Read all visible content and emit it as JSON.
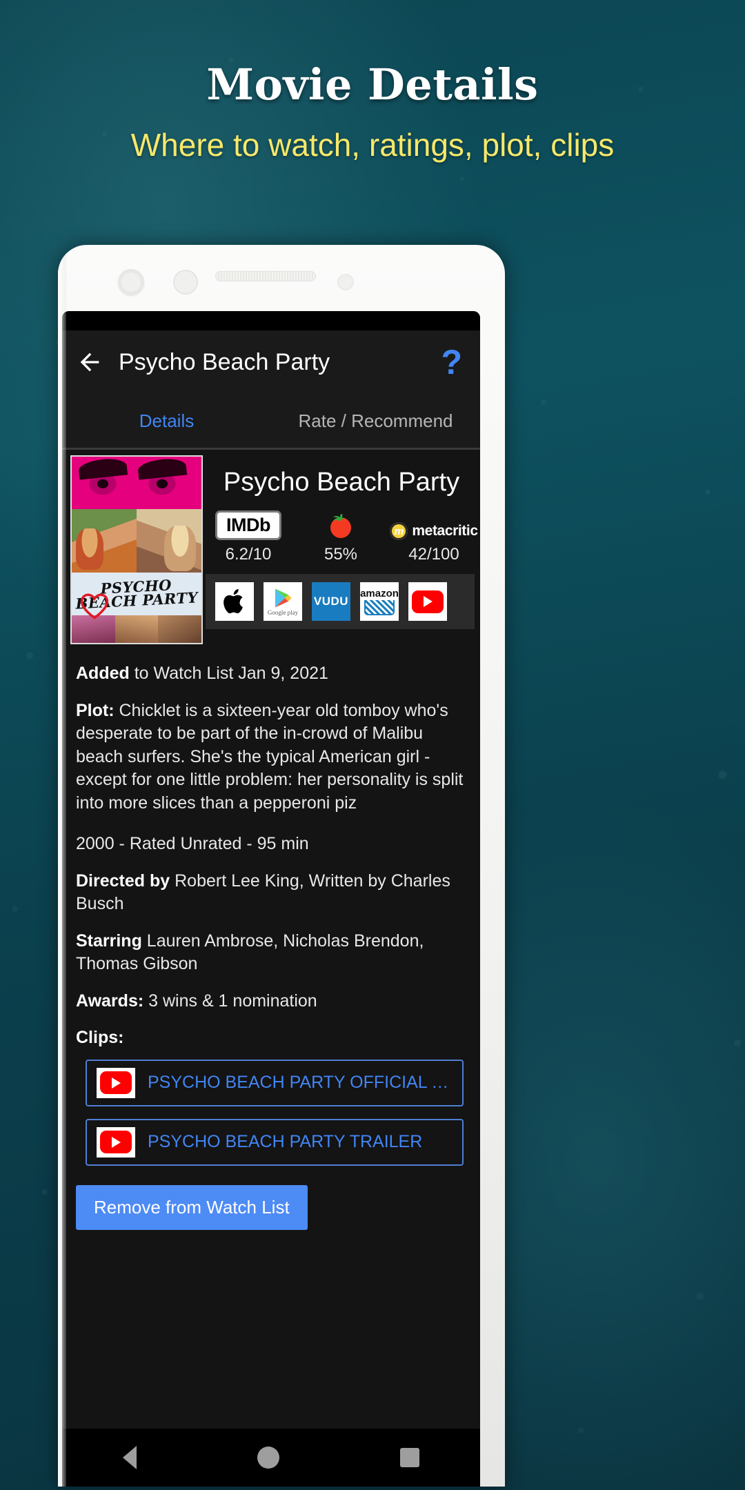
{
  "promo": {
    "title": "Movie Details",
    "subtitle": "Where to watch, ratings,  plot, clips",
    "title_color": "#ffffff",
    "subtitle_color": "#f6e86a",
    "background_color": "#0d4b55"
  },
  "appbar": {
    "back_icon": "arrow-left",
    "title": "Psycho Beach Party",
    "help_icon": "?",
    "accent_color": "#4285f4"
  },
  "tabs": [
    {
      "label": "Details",
      "active": true
    },
    {
      "label": "Rate / Recommend",
      "active": false
    }
  ],
  "hero": {
    "poster_alt": "Psycho Beach Party poster",
    "poster_title_line1": "PSYCHO",
    "poster_title_line2": "BEACH PARTY",
    "movie_title": "Psycho Beach Party",
    "ratings": [
      {
        "source": "IMDb",
        "logo": "imdb-logo",
        "value": "6.2/10"
      },
      {
        "source": "Rotten Tomatoes",
        "logo": "tomato-icon",
        "value": "55%"
      },
      {
        "source": "Metacritic",
        "logo": "metacritic-logo",
        "label": "metacritic",
        "value": "42/100"
      }
    ],
    "providers": [
      {
        "name": "Apple",
        "icon": "apple-icon"
      },
      {
        "name": "Google Play",
        "icon": "google-play-icon",
        "caption": "Google play"
      },
      {
        "name": "VUDU",
        "icon": "vudu-icon",
        "label": "VUDU"
      },
      {
        "name": "Amazon",
        "icon": "amazon-icon",
        "label": "amazon"
      },
      {
        "name": "YouTube",
        "icon": "youtube-icon"
      }
    ]
  },
  "details": {
    "added_label": "Added",
    "added_text": " to Watch List Jan 9, 2021",
    "plot_label": "Plot:",
    "plot_text": " Chicklet is a sixteen-year old tomboy who's desperate to be part of the in-crowd of Malibu beach surfers. She's the typical American girl - except for one little problem: her personality is split into more slices than a pepperoni piz",
    "meta_line": "2000 - Rated Unrated - 95 min",
    "directed_label": "Directed by",
    "directed_text": " Robert Lee King, Written by Charles Busch",
    "starring_label": "Starring",
    "starring_text": " Lauren Ambrose, Nicholas Brendon, Thomas Gibson",
    "awards_label": "Awards:",
    "awards_text": " 3 wins & 1 nomination",
    "clips_label": "Clips:"
  },
  "clips": [
    {
      "icon": "youtube-icon",
      "title": "PSYCHO BEACH PARTY OFFICIAL TR…"
    },
    {
      "icon": "youtube-icon",
      "title": "PSYCHO BEACH PARTY TRAILER"
    }
  ],
  "actions": {
    "remove_label": "Remove from Watch List",
    "remove_color": "#4d8bf5"
  },
  "navbar": {
    "back": "nav-back-triangle",
    "home": "nav-home-circle",
    "recent": "nav-recent-square"
  }
}
